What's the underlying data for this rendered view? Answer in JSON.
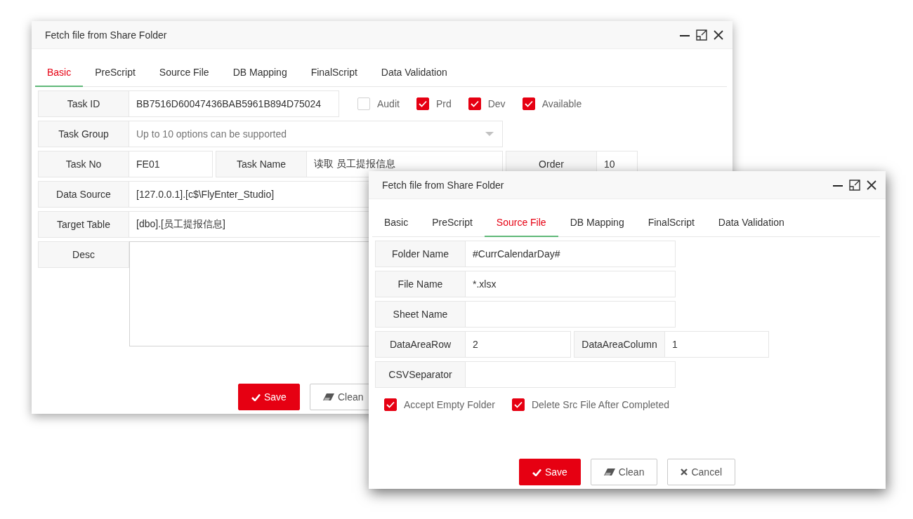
{
  "windows": [
    {
      "title": "Fetch file from Share Folder",
      "tabs": [
        {
          "label": "Basic",
          "selected": true
        },
        {
          "label": "PreScript",
          "selected": false
        },
        {
          "label": "Source File",
          "selected": false
        },
        {
          "label": "DB Mapping",
          "selected": false
        },
        {
          "label": "FinalScript",
          "selected": false
        },
        {
          "label": "Data Validation",
          "selected": false
        }
      ],
      "rows": [
        {
          "fields": [
            {
              "kind": "field",
              "label": "Task ID",
              "value": "BB7516D60047436BAB5961B894D75024"
            },
            {
              "kind": "checkbox",
              "label": "Audit",
              "checked": false
            },
            {
              "kind": "checkbox",
              "label": "Prd",
              "checked": true
            },
            {
              "kind": "checkbox",
              "label": "Dev",
              "checked": true
            },
            {
              "kind": "checkbox",
              "label": "Available",
              "checked": true
            }
          ]
        },
        {
          "fields": [
            {
              "kind": "select",
              "label": "Task Group",
              "placeholder": "Up to 10 options can be supported"
            }
          ]
        },
        {
          "fields": [
            {
              "kind": "field",
              "label": "Task No",
              "value": "FE01"
            },
            {
              "kind": "field",
              "label": "Task Name",
              "value": "读取 员工提报信息"
            },
            {
              "kind": "field",
              "label": "Order",
              "value": "10"
            }
          ]
        },
        {
          "fields": [
            {
              "kind": "field",
              "label": "Data Source",
              "value": "[127.0.0.1].[c$\\FlyEnter_Studio]"
            }
          ]
        },
        {
          "fields": [
            {
              "kind": "field",
              "label": "Target Table",
              "value": "[dbo].[员工提报信息]"
            }
          ]
        },
        {
          "fields": [
            {
              "kind": "textarea",
              "label": "Desc"
            }
          ]
        }
      ],
      "buttons": [
        {
          "kind": "save",
          "label": "Save"
        },
        {
          "kind": "clean",
          "label": "Clean"
        }
      ]
    },
    {
      "title": "Fetch file from Share Folder",
      "tabs": [
        {
          "label": "Basic",
          "selected": false
        },
        {
          "label": "PreScript",
          "selected": false
        },
        {
          "label": "Source File",
          "selected": true
        },
        {
          "label": "DB Mapping",
          "selected": false
        },
        {
          "label": "FinalScript",
          "selected": false
        },
        {
          "label": "Data Validation",
          "selected": false
        }
      ],
      "rows": [
        {
          "fields": [
            {
              "kind": "field",
              "label": "Folder Name",
              "value": "#CurrCalendarDay#"
            }
          ]
        },
        {
          "fields": [
            {
              "kind": "field",
              "label": "File Name",
              "value": "*.xlsx"
            }
          ]
        },
        {
          "fields": [
            {
              "kind": "field",
              "label": "Sheet Name"
            }
          ]
        },
        {
          "fields": [
            {
              "kind": "field",
              "label": "DataAreaRow",
              "value": "2"
            },
            {
              "kind": "field",
              "label": "DataAreaColumn",
              "value": "1"
            }
          ]
        },
        {
          "fields": [
            {
              "kind": "field",
              "label": "CSVSeparator"
            }
          ]
        },
        {
          "fields": [
            {
              "kind": "checkbox",
              "label": "Accept Empty Folder",
              "checked": true
            },
            {
              "kind": "checkbox",
              "label": "Delete Src File After Completed",
              "checked": true
            }
          ]
        }
      ],
      "buttons": [
        {
          "kind": "save",
          "label": "Save"
        },
        {
          "kind": "clean",
          "label": "Clean"
        },
        {
          "kind": "cancel",
          "label": "Cancel"
        }
      ]
    }
  ]
}
